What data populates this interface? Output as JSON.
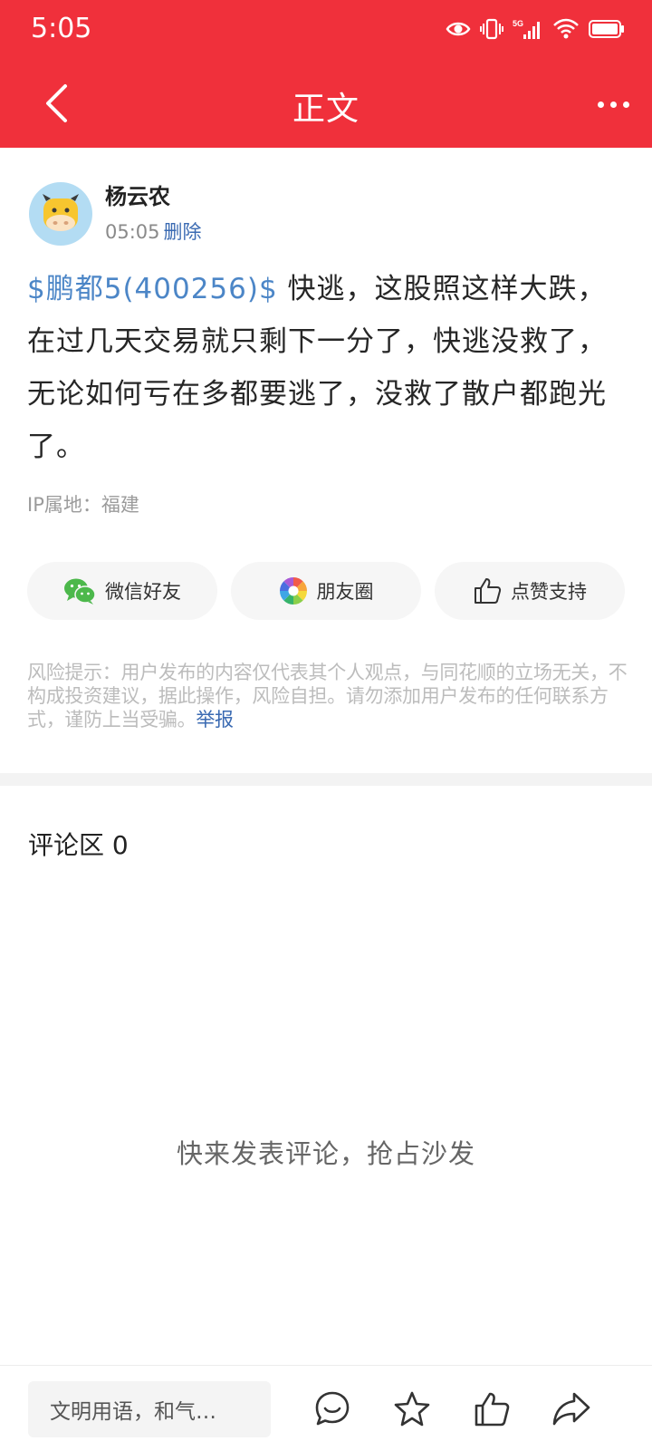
{
  "colors": {
    "brand": "#f0303b",
    "link": "#3a6ab2",
    "stock": "#4c86c7"
  },
  "status_bar": {
    "time": "5:05",
    "network": "5G"
  },
  "header": {
    "title": "正文",
    "back_icon": "chevron-left-icon",
    "more_icon": "more-horizontal-icon"
  },
  "post": {
    "author": "杨云农",
    "time": "05:05",
    "delete_label": "删除",
    "stock_tag": "$鹏都5(400256)$",
    "content": " 快逃，这股照这样大跌，在过几天交易就只剩下一分了，快逃没救了，无论如何亏在多都要逃了，没救了散户都跑光了。",
    "ip_location": "IP属地：福建"
  },
  "share": {
    "wechat": "微信好友",
    "moments": "朋友圈",
    "like": "点赞支持"
  },
  "risk": {
    "text": "风险提示：用户发布的内容仅代表其个人观点，与同花顺的立场无关，不构成投资建议，据此操作，风险自担。请勿添加用户发布的任何联系方式，谨防上当受骗。",
    "report": "举报"
  },
  "comments": {
    "title": "评论区 0",
    "empty": "快来发表评论，抢占沙发"
  },
  "bottom_bar": {
    "input_placeholder": "文明用语，和气…",
    "icons": [
      "comment-icon",
      "star-icon",
      "thumbs-up-icon",
      "share-icon"
    ]
  }
}
